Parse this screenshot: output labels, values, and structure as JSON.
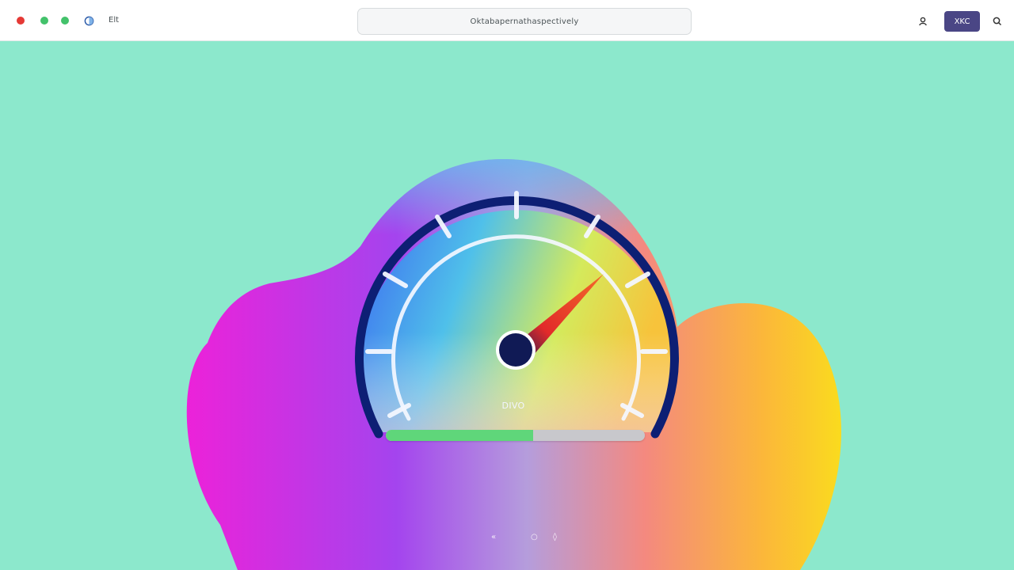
{
  "topbar": {
    "label": "Elt",
    "address": "Oktabapernathaspectively",
    "button_label": "XKC"
  },
  "gauge": {
    "value_label": "DIVO",
    "fill_fraction": 0.57
  },
  "controls": {
    "prev": "«",
    "play": "○",
    "next": "◊"
  },
  "colors": {
    "background": "#8ce8cc",
    "button": "#4a4685",
    "needle": "#e5322f",
    "hub": "#101a55",
    "progress": "#5fd67a"
  },
  "icons": {
    "window_dots": [
      "red-dot",
      "green-dot",
      "green-dot"
    ],
    "site": "globe-icon",
    "left": "user-icon",
    "right": "search-icon"
  }
}
